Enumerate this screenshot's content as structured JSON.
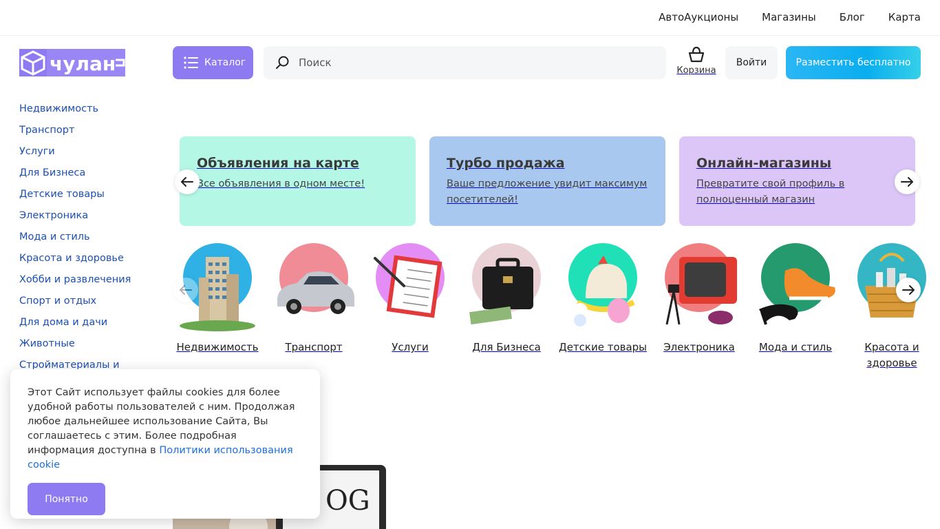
{
  "topnav": [
    "АвтоАукционы",
    "Магазины",
    "Блог",
    "Карта"
  ],
  "logo_text": "чулан",
  "header": {
    "catalog_label": "Каталог",
    "search_placeholder": "Поиск",
    "cart_label": "Корзина",
    "login_label": "Войти",
    "post_label": "Разместить бесплатно"
  },
  "sidebar": [
    "Недвижимость",
    "Транспорт",
    "Услуги",
    "Для Бизнеса",
    "Детские товары",
    "Электроника",
    "Мода и стиль",
    "Красота и здоровье",
    "Хобби и развлечения",
    "Спорт и отдых",
    "Для дома и дачи",
    "Животные",
    "Стройматериалы и"
  ],
  "promos": [
    {
      "title": "Объявления на карте",
      "text": "Все объявления в одном месте!"
    },
    {
      "title": "Турбо продажа",
      "text": "Ваше предложение увидит максимум посетителей!"
    },
    {
      "title": "Онлайн-магазины",
      "text": "Превратите свой профиль в полноценный магазин"
    }
  ],
  "categories": [
    {
      "label": "Недвижимость",
      "icon": "building-icon",
      "color": "#2fb1e6"
    },
    {
      "label": "Транспорт",
      "icon": "car-icon",
      "color": "#ef8c96"
    },
    {
      "label": "Услуги",
      "icon": "checklist-icon",
      "color": "#e48ef5"
    },
    {
      "label": "Для Бизнеса",
      "icon": "briefcase-icon",
      "color": "#e9d1d6"
    },
    {
      "label": "Детские товары",
      "icon": "toy-horse-icon",
      "color": "#1fe0b6"
    },
    {
      "label": "Электроника",
      "icon": "tv-icon",
      "color": "#f07e80"
    },
    {
      "label": "Мода и стиль",
      "icon": "shoes-icon",
      "color": "#249a6e"
    },
    {
      "label": "Красота и здоровье",
      "icon": "gift-basket-icon",
      "color": "#34b6c4"
    }
  ],
  "cookie": {
    "text": "Этот Сайт использует файлы cookies для более удобной работы пользователей с ним. Продолжая любое дальнейшее использование Сайта, Вы соглашаетесь с этим. Более подробная информация доступна в ",
    "link": "Политики использования cookie",
    "button": "Понятно"
  },
  "colors": {
    "accent": "#8e7bf2",
    "link": "#1c4fb3",
    "cta": "#0aaeee"
  }
}
